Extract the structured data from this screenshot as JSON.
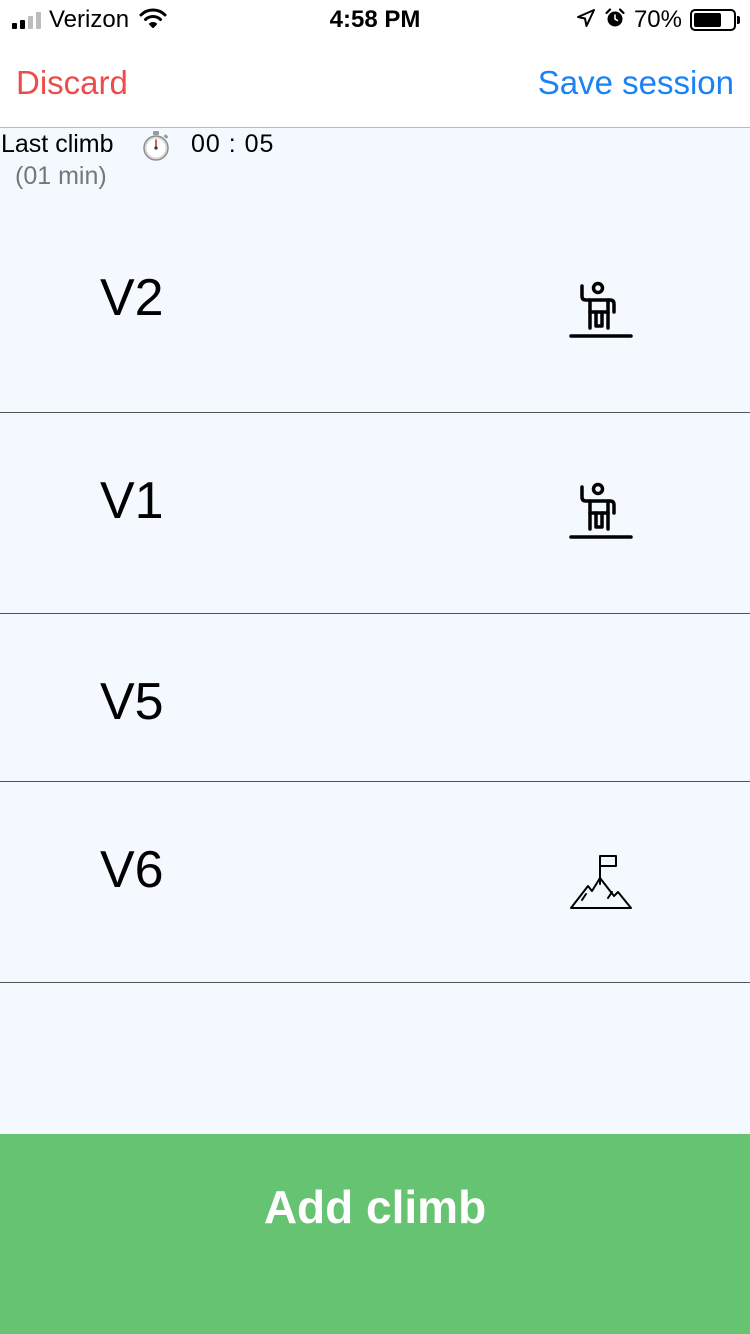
{
  "status_bar": {
    "carrier": "Verizon",
    "time": "4:58 PM",
    "battery_percent": "70%",
    "battery_level": 0.7,
    "signal_bars": 2
  },
  "nav": {
    "discard_label": "Discard",
    "save_label": "Save session"
  },
  "last_climb": {
    "label": "Last climb",
    "time": "00 : 05",
    "minutes": "(01 min)"
  },
  "climbs": [
    {
      "grade": "V2",
      "icon": "climber-topped-icon"
    },
    {
      "grade": "V1",
      "icon": "climber-topped-icon"
    },
    {
      "grade": "V5",
      "icon": "none"
    },
    {
      "grade": "V6",
      "icon": "mountain-flag-icon"
    }
  ],
  "add_climb_label": "Add climb",
  "colors": {
    "discard": "#ee4b4b",
    "save": "#1a82f7",
    "add_button": "#65c372",
    "content_bg": "#f3f9fe"
  }
}
